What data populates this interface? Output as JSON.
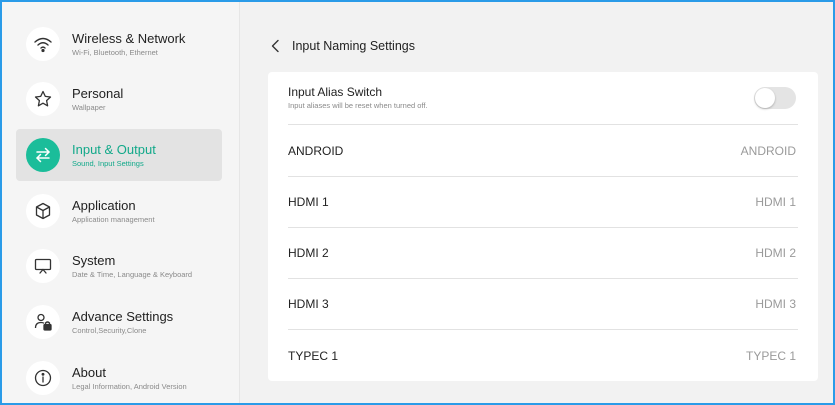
{
  "sidebar": {
    "items": [
      {
        "title": "Wireless & Network",
        "subtitle": "Wi-Fi, Bluetooth, Ethernet",
        "icon": "wifi-icon"
      },
      {
        "title": "Personal",
        "subtitle": "Wallpaper",
        "icon": "star-icon"
      },
      {
        "title": "Input & Output",
        "subtitle": "Sound, Input Settings",
        "icon": "swap-arrows-icon",
        "active": true
      },
      {
        "title": "Application",
        "subtitle": "Application management",
        "icon": "cube-icon"
      },
      {
        "title": "System",
        "subtitle": "Date & Time, Language & Keyboard",
        "icon": "monitor-icon"
      },
      {
        "title": "Advance Settings",
        "subtitle": "Control,Security,Clone",
        "icon": "user-lock-icon"
      },
      {
        "title": "About",
        "subtitle": "Legal Information, Android Version",
        "icon": "info-icon"
      }
    ]
  },
  "header": {
    "title": "Input Naming Settings"
  },
  "alias": {
    "title": "Input Alias Switch",
    "subtitle": "Input aliases will be reset when turned off.",
    "enabled": false
  },
  "inputs": [
    {
      "label": "ANDROID",
      "value": "ANDROID"
    },
    {
      "label": "HDMI 1",
      "value": "HDMI 1"
    },
    {
      "label": "HDMI 2",
      "value": "HDMI 2"
    },
    {
      "label": "HDMI 3",
      "value": "HDMI 3"
    },
    {
      "label": "TYPEC 1",
      "value": "TYPEC 1"
    }
  ],
  "colors": {
    "accent": "#1bbd9a",
    "accent_text": "#12a98a",
    "border": "#2a9be8"
  }
}
